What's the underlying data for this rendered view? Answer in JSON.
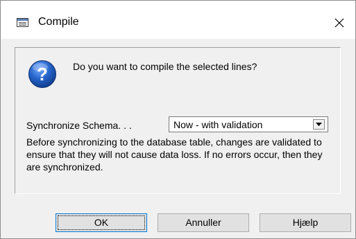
{
  "window": {
    "title": "Compile",
    "close_glyph": "✕"
  },
  "message": {
    "question": "Do you want to compile the selected lines?",
    "icon": "question-icon"
  },
  "sync": {
    "label": "Synchronize Schema. . .",
    "selected": "Now - with validation"
  },
  "description": "Before synchronizing to the database table, changes are validated to ensure that they will not cause data loss. If no errors occur, then they are synchronized.",
  "buttons": {
    "ok": "OK",
    "cancel": "Annuller",
    "help": "Hjælp"
  },
  "colors": {
    "accent": "#0078d7",
    "question_icon_blue": "#1a5fb4"
  }
}
